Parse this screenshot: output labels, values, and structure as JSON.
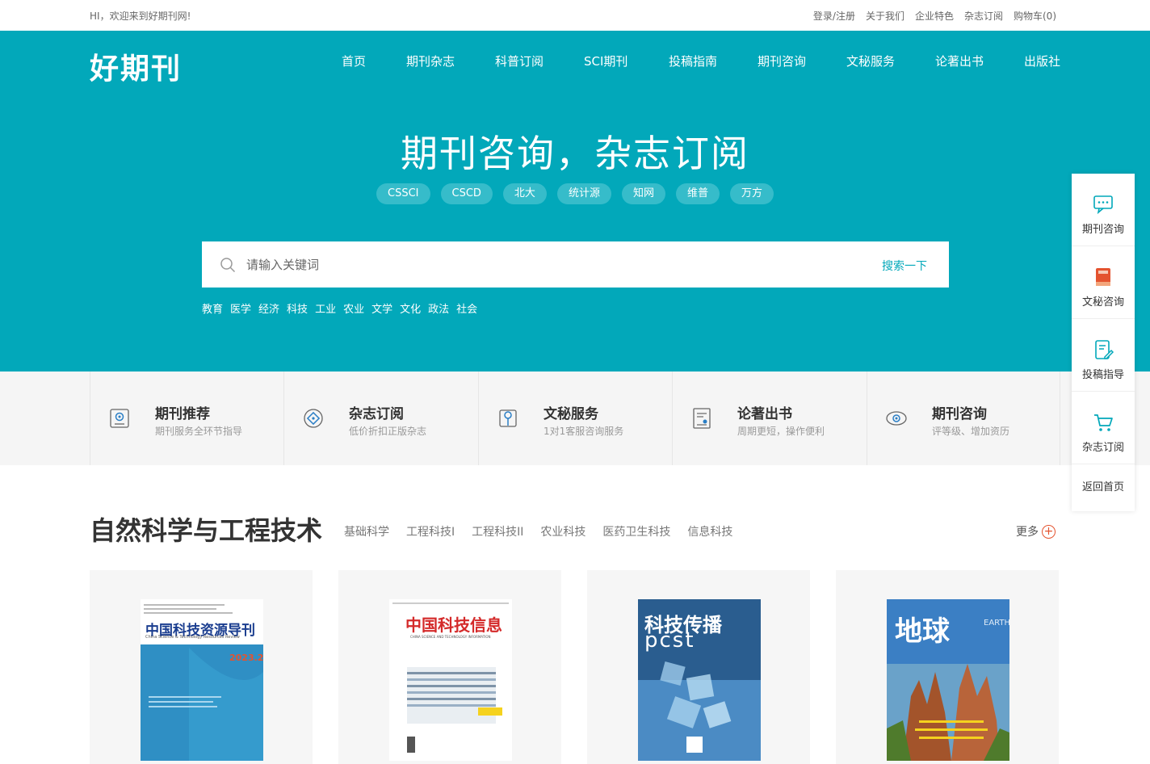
{
  "topbar": {
    "welcome": "HI，欢迎来到好期刊网!",
    "links": [
      "登录/注册",
      "关于我们",
      "企业特色",
      "杂志订阅",
      "购物车(0)"
    ]
  },
  "header": {
    "logo": "好期刊",
    "nav": [
      "首页",
      "期刊杂志",
      "科普订阅",
      "SCI期刊",
      "投稿指南",
      "期刊咨询",
      "文秘服务",
      "论著出书",
      "出版社"
    ]
  },
  "hero": {
    "title": "期刊咨询，杂志订阅",
    "tags": [
      "CSSCI",
      "CSCD",
      "北大",
      "统计源",
      "知网",
      "维普",
      "万方"
    ]
  },
  "search": {
    "placeholder": "请输入关键词",
    "button": "搜索一下",
    "categories": [
      "教育",
      "医学",
      "经济",
      "科技",
      "工业",
      "农业",
      "文学",
      "文化",
      "政法",
      "社会"
    ]
  },
  "services": [
    {
      "title": "期刊推荐",
      "desc": "期刊服务全环节指导",
      "icon": "journal-icon"
    },
    {
      "title": "杂志订阅",
      "desc": "低价折扣正版杂志",
      "icon": "subscribe-icon"
    },
    {
      "title": "文秘服务",
      "desc": "1对1客服咨询服务",
      "icon": "secretary-icon"
    },
    {
      "title": "论著出书",
      "desc": "周期更短，操作便利",
      "icon": "book-publish-icon"
    },
    {
      "title": "期刊咨询",
      "desc": "评等级、增加资历",
      "icon": "consult-icon"
    }
  ],
  "sidebar": {
    "items": [
      {
        "label": "期刊咨询",
        "icon": "chat-icon"
      },
      {
        "label": "文秘咨询",
        "icon": "notebook-icon"
      },
      {
        "label": "投稿指导",
        "icon": "edit-doc-icon"
      },
      {
        "label": "杂志订阅",
        "icon": "cart-icon"
      }
    ],
    "home": "返回首页"
  },
  "section": {
    "title": "自然科学与工程技术",
    "tabs": [
      "基础科学",
      "工程科技I",
      "工程科技II",
      "农业科技",
      "医药卫生科技",
      "信息科技"
    ],
    "more": "更多",
    "covers": [
      {
        "title": "中国科技资源导刊",
        "subtitle": "China Science & Technology Resources Review",
        "issue": "2023.2"
      },
      {
        "title": "中国科技信息",
        "subtitle": "CHINA SCIENCE AND TECHNOLOGY INFORMATION"
      },
      {
        "title": "科技传播",
        "subtitle": "pcst"
      },
      {
        "title": "地球",
        "subtitle": "EARTH"
      }
    ]
  },
  "colors": {
    "brand": "#02a8ba",
    "accent": "#e4532f"
  }
}
